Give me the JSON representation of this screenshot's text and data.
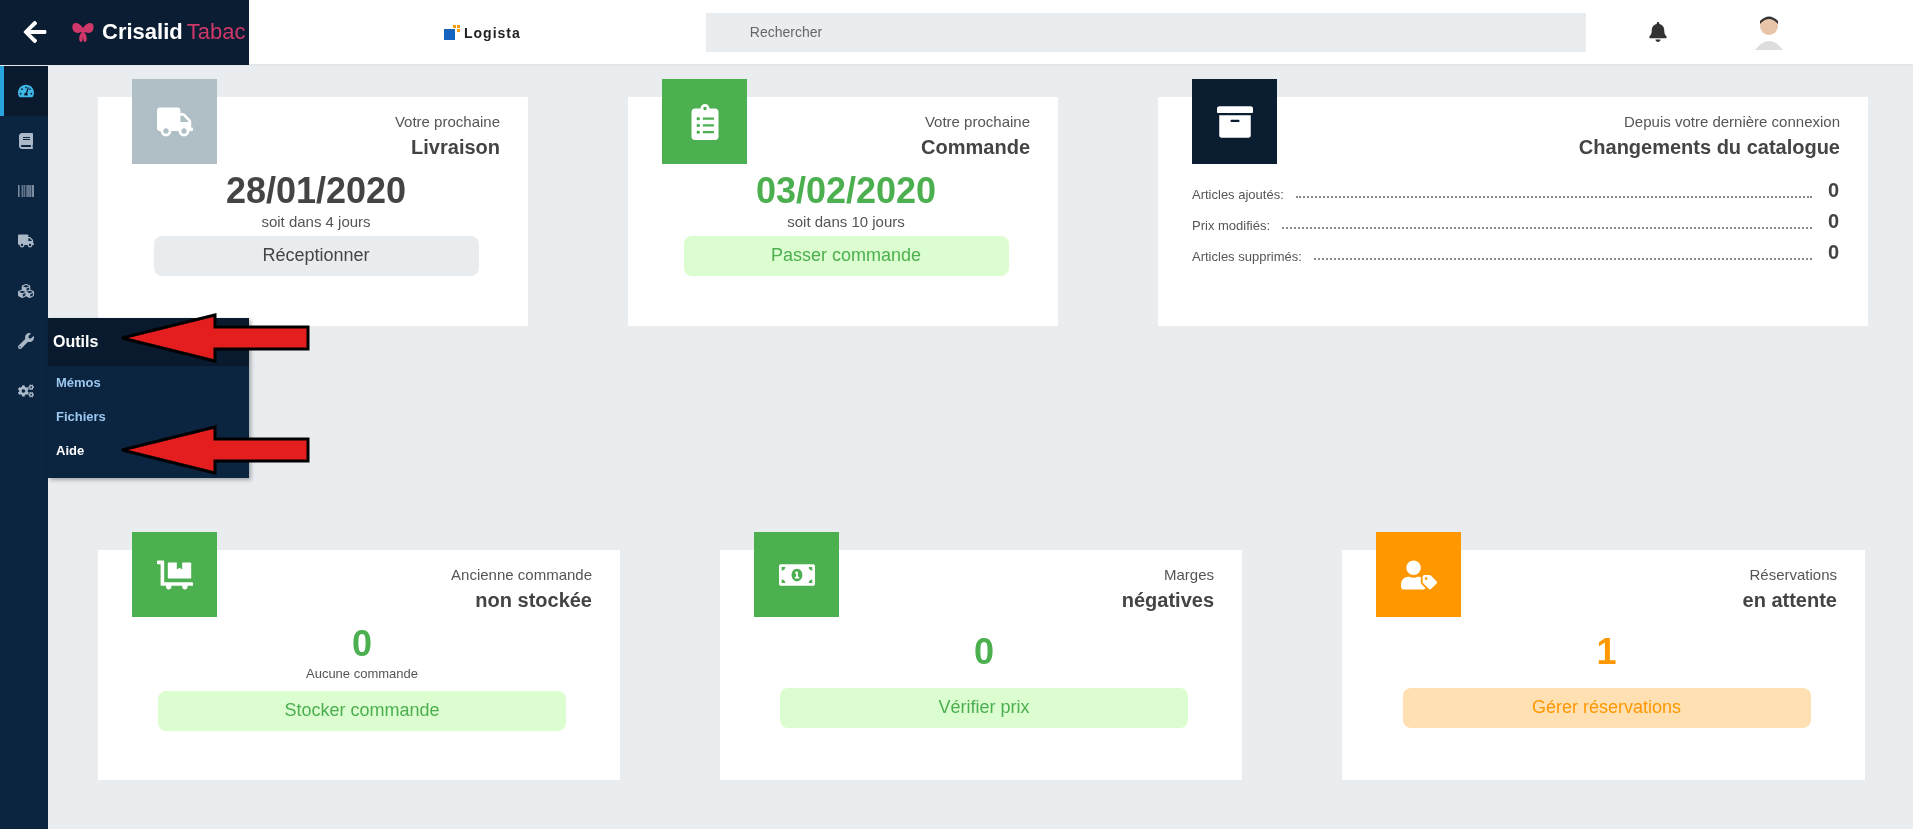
{
  "header": {
    "brand": "Crisalid",
    "brand_suffix": "Tabac",
    "partner": "Logista",
    "search": {
      "placeholder": "Rechercher"
    }
  },
  "sidebar": {
    "items": [
      {
        "selected": true
      },
      {
        "selected": false
      },
      {
        "selected": false
      },
      {
        "selected": false
      },
      {
        "selected": false
      },
      {
        "selected": false
      },
      {
        "selected": false
      }
    ]
  },
  "flyout": {
    "title": "Outils",
    "items": [
      {
        "label": "Mémos",
        "selected": false
      },
      {
        "label": "Fichiers",
        "selected": false
      },
      {
        "label": "Aide",
        "selected": true
      }
    ]
  },
  "cards_top": [
    {
      "kind": "date",
      "color": "#b0bec5",
      "subtitle": "Votre prochaine",
      "title": "Livraison",
      "value": "28/01/2020",
      "note": "soit dans 4 jours",
      "action": "Réceptionner"
    },
    {
      "kind": "date",
      "color": "#4caf50",
      "subtitle": "Votre prochaine",
      "title": "Commande",
      "value": "03/02/2020",
      "note": "soit dans 10 jours",
      "action": "Passer commande"
    },
    {
      "kind": "catalog",
      "color": "#0b1d31",
      "subtitle": "Depuis votre dernière connexion",
      "title": "Changements du catalogue",
      "rows": [
        {
          "label": "Articles ajoutés:",
          "value": "0"
        },
        {
          "label": "Prix modifiés:",
          "value": "0"
        },
        {
          "label": "Articles supprimés:",
          "value": "0"
        }
      ]
    }
  ],
  "cards_bottom": [
    {
      "kind": "count",
      "color": "#4caf50",
      "subtitle": "Ancienne commande",
      "title": "non stockée",
      "value": "0",
      "note": "Aucune commande",
      "action": "Stocker commande"
    },
    {
      "kind": "count",
      "color": "#4caf50",
      "subtitle": "Marges",
      "title": "négatives",
      "value": "0",
      "action": "Vérifier prix"
    },
    {
      "kind": "count",
      "color": "#ff9800",
      "subtitle": "Réservations",
      "title": "en attente",
      "value": "1",
      "action": "Gérer réservations"
    }
  ]
}
